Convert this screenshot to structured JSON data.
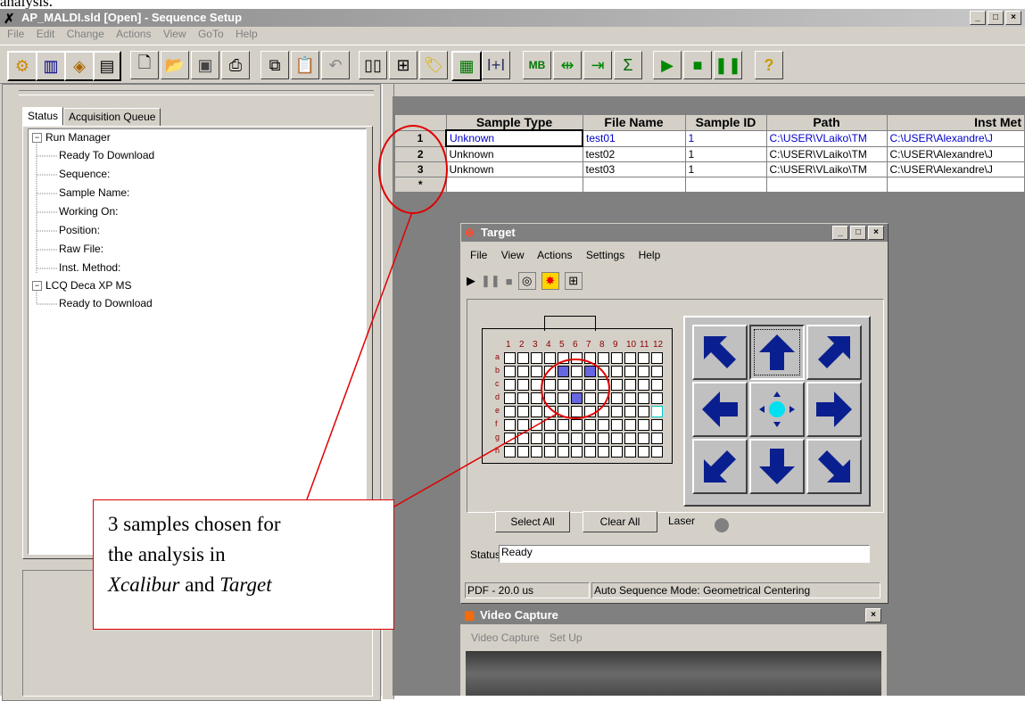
{
  "doc_fragment": "analysis.",
  "window": {
    "title": "AP_MALDI.sld [Open] - Sequence Setup",
    "min": "_",
    "max": "□",
    "close": "×"
  },
  "menu": [
    "File",
    "Edit",
    "Change",
    "Actions",
    "View",
    "GoTo",
    "Help"
  ],
  "left_panel": {
    "tabs": [
      "Status",
      "Acquisition Queue"
    ],
    "tree": [
      {
        "label": "Run Manager",
        "expander": "−",
        "children": [
          "Ready To Download",
          "Sequence:",
          "Sample Name:",
          "Working On:",
          "Position:",
          "Raw File:",
          "Inst. Method:"
        ]
      },
      {
        "label": "LCQ Deca XP MS",
        "expander": "−",
        "children": [
          "Ready to Download"
        ]
      }
    ]
  },
  "sequence_grid": {
    "columns": [
      "",
      "Sample Type",
      "File Name",
      "Sample ID",
      "Path",
      "Inst Met"
    ],
    "rows": [
      {
        "num": "1",
        "type": "Unknown",
        "file": "test01",
        "id": "1",
        "path": "C:\\USER\\VLaiko\\TM",
        "inst": "C:\\USER\\Alexandre\\J",
        "selected": true
      },
      {
        "num": "2",
        "type": "Unknown",
        "file": "test02",
        "id": "1",
        "path": "C:\\USER\\VLaiko\\TM",
        "inst": "C:\\USER\\Alexandre\\J",
        "selected": false
      },
      {
        "num": "3",
        "type": "Unknown",
        "file": "test03",
        "id": "1",
        "path": "C:\\USER\\VLaiko\\TM",
        "inst": "C:\\USER\\Alexandre\\J",
        "selected": false
      },
      {
        "num": "*",
        "type": "",
        "file": "",
        "id": "",
        "path": "",
        "inst": "",
        "selected": false
      }
    ]
  },
  "target_window": {
    "title": "Target",
    "menu": [
      "File",
      "View",
      "Actions",
      "Settings",
      "Help"
    ],
    "plate": {
      "columns": [
        "1",
        "2",
        "3",
        "4",
        "5",
        "6",
        "7",
        "8",
        "9",
        "10",
        "11",
        "12"
      ],
      "rows": [
        "a",
        "b",
        "c",
        "d",
        "e",
        "f",
        "g",
        "h"
      ],
      "selected_wells": [
        "b5",
        "b7",
        "d6"
      ],
      "current_well": "e12"
    },
    "buttons": {
      "select_all": "Select All",
      "clear_all": "Clear All"
    },
    "laser_label": "Laser",
    "status_label": "Status:",
    "status_value": "Ready",
    "statusbar": [
      "PDF - 20.0 us",
      "Auto Sequence Mode: Geometrical Centering"
    ]
  },
  "video_window": {
    "title": "Video Capture",
    "menu": [
      "Video Capture",
      "Set Up"
    ],
    "close": "×"
  },
  "annotation": {
    "line1": "3 samples chosen for",
    "line2": "the analysis in",
    "italic1": "Xcalibur",
    "joiner": " and ",
    "italic2": "Target",
    "color": "#e00000"
  }
}
